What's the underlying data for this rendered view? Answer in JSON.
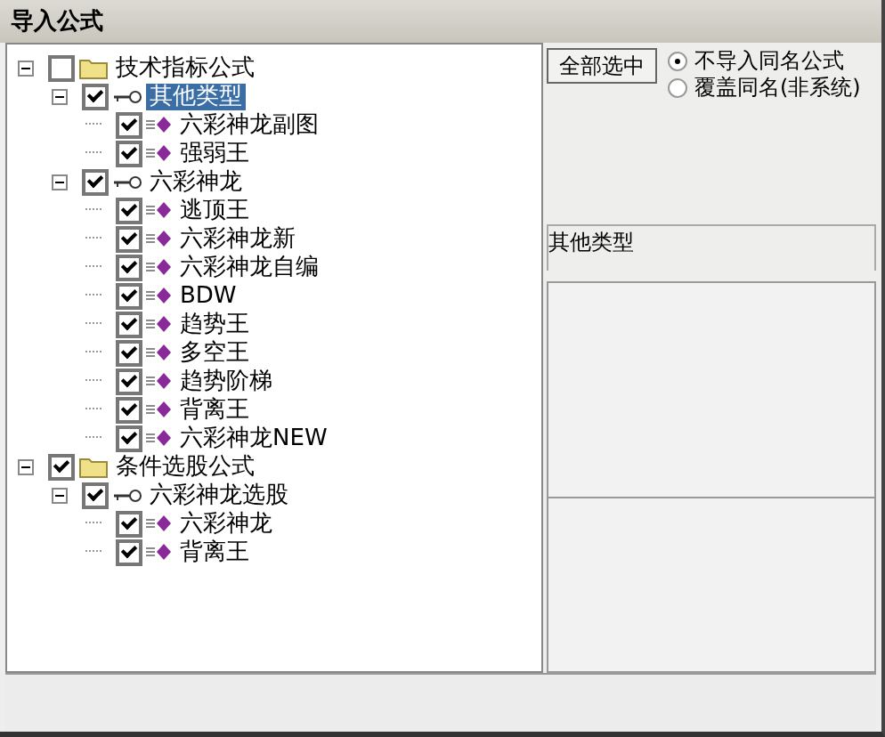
{
  "window": {
    "title": "导入公式"
  },
  "tree": [
    {
      "label": "技术指标公式",
      "kind": "folder",
      "checked": false,
      "expanded": true,
      "selected": false,
      "children": [
        {
          "label": "其他类型",
          "kind": "group",
          "checked": true,
          "expanded": true,
          "selected": true,
          "children": [
            {
              "label": "六彩神龙副图",
              "kind": "formula",
              "checked": true,
              "selected": false
            },
            {
              "label": "强弱王",
              "kind": "formula",
              "checked": true,
              "selected": false
            }
          ]
        },
        {
          "label": "六彩神龙",
          "kind": "group",
          "checked": true,
          "expanded": true,
          "selected": false,
          "children": [
            {
              "label": "逃顶王",
              "kind": "formula",
              "checked": true,
              "selected": false
            },
            {
              "label": "六彩神龙新",
              "kind": "formula",
              "checked": true,
              "selected": false
            },
            {
              "label": "六彩神龙自编",
              "kind": "formula",
              "checked": true,
              "selected": false
            },
            {
              "label": "BDW",
              "kind": "formula",
              "checked": true,
              "selected": false
            },
            {
              "label": "趋势王",
              "kind": "formula",
              "checked": true,
              "selected": false
            },
            {
              "label": "多空王",
              "kind": "formula",
              "checked": true,
              "selected": false
            },
            {
              "label": "趋势阶梯",
              "kind": "formula",
              "checked": true,
              "selected": false
            },
            {
              "label": "背离王",
              "kind": "formula",
              "checked": true,
              "selected": false
            },
            {
              "label": "六彩神龙NEW",
              "kind": "formula",
              "checked": true,
              "selected": false
            }
          ]
        }
      ]
    },
    {
      "label": "条件选股公式",
      "kind": "folder",
      "checked": true,
      "expanded": true,
      "selected": false,
      "children": [
        {
          "label": "六彩神龙选股",
          "kind": "group",
          "checked": true,
          "expanded": true,
          "selected": false,
          "children": [
            {
              "label": "六彩神龙",
              "kind": "formula",
              "checked": true,
              "selected": false
            },
            {
              "label": "背离王",
              "kind": "formula",
              "checked": true,
              "selected": false
            }
          ]
        }
      ]
    }
  ],
  "select_all_button": "全部选中",
  "import_options": [
    {
      "label": "不导入同名公式",
      "selected": true
    },
    {
      "label": "覆盖同名(非系统)",
      "selected": false
    }
  ],
  "description_label": "其他类型"
}
